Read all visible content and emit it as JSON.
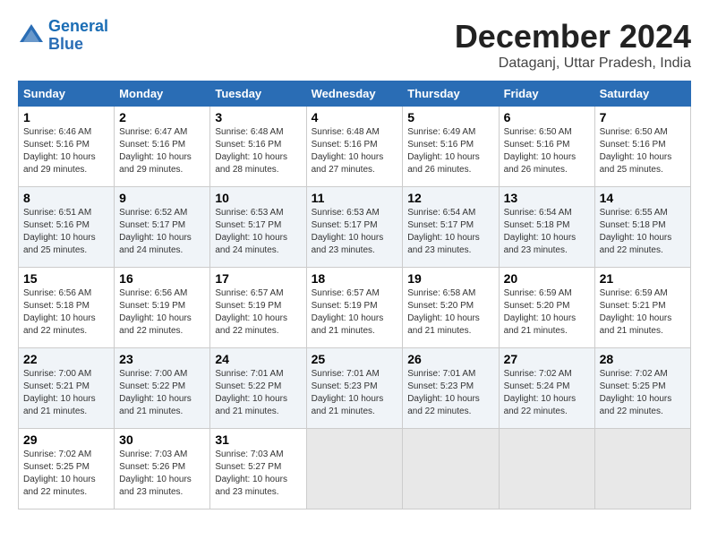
{
  "logo": {
    "line1": "General",
    "line2": "Blue"
  },
  "title": "December 2024",
  "location": "Dataganj, Uttar Pradesh, India",
  "days_of_week": [
    "Sunday",
    "Monday",
    "Tuesday",
    "Wednesday",
    "Thursday",
    "Friday",
    "Saturday"
  ],
  "weeks": [
    [
      {
        "day": "1",
        "sunrise": "Sunrise: 6:46 AM",
        "sunset": "Sunset: 5:16 PM",
        "daylight": "Daylight: 10 hours and 29 minutes."
      },
      {
        "day": "2",
        "sunrise": "Sunrise: 6:47 AM",
        "sunset": "Sunset: 5:16 PM",
        "daylight": "Daylight: 10 hours and 29 minutes."
      },
      {
        "day": "3",
        "sunrise": "Sunrise: 6:48 AM",
        "sunset": "Sunset: 5:16 PM",
        "daylight": "Daylight: 10 hours and 28 minutes."
      },
      {
        "day": "4",
        "sunrise": "Sunrise: 6:48 AM",
        "sunset": "Sunset: 5:16 PM",
        "daylight": "Daylight: 10 hours and 27 minutes."
      },
      {
        "day": "5",
        "sunrise": "Sunrise: 6:49 AM",
        "sunset": "Sunset: 5:16 PM",
        "daylight": "Daylight: 10 hours and 26 minutes."
      },
      {
        "day": "6",
        "sunrise": "Sunrise: 6:50 AM",
        "sunset": "Sunset: 5:16 PM",
        "daylight": "Daylight: 10 hours and 26 minutes."
      },
      {
        "day": "7",
        "sunrise": "Sunrise: 6:50 AM",
        "sunset": "Sunset: 5:16 PM",
        "daylight": "Daylight: 10 hours and 25 minutes."
      }
    ],
    [
      {
        "day": "8",
        "sunrise": "Sunrise: 6:51 AM",
        "sunset": "Sunset: 5:16 PM",
        "daylight": "Daylight: 10 hours and 25 minutes."
      },
      {
        "day": "9",
        "sunrise": "Sunrise: 6:52 AM",
        "sunset": "Sunset: 5:17 PM",
        "daylight": "Daylight: 10 hours and 24 minutes."
      },
      {
        "day": "10",
        "sunrise": "Sunrise: 6:53 AM",
        "sunset": "Sunset: 5:17 PM",
        "daylight": "Daylight: 10 hours and 24 minutes."
      },
      {
        "day": "11",
        "sunrise": "Sunrise: 6:53 AM",
        "sunset": "Sunset: 5:17 PM",
        "daylight": "Daylight: 10 hours and 23 minutes."
      },
      {
        "day": "12",
        "sunrise": "Sunrise: 6:54 AM",
        "sunset": "Sunset: 5:17 PM",
        "daylight": "Daylight: 10 hours and 23 minutes."
      },
      {
        "day": "13",
        "sunrise": "Sunrise: 6:54 AM",
        "sunset": "Sunset: 5:18 PM",
        "daylight": "Daylight: 10 hours and 23 minutes."
      },
      {
        "day": "14",
        "sunrise": "Sunrise: 6:55 AM",
        "sunset": "Sunset: 5:18 PM",
        "daylight": "Daylight: 10 hours and 22 minutes."
      }
    ],
    [
      {
        "day": "15",
        "sunrise": "Sunrise: 6:56 AM",
        "sunset": "Sunset: 5:18 PM",
        "daylight": "Daylight: 10 hours and 22 minutes."
      },
      {
        "day": "16",
        "sunrise": "Sunrise: 6:56 AM",
        "sunset": "Sunset: 5:19 PM",
        "daylight": "Daylight: 10 hours and 22 minutes."
      },
      {
        "day": "17",
        "sunrise": "Sunrise: 6:57 AM",
        "sunset": "Sunset: 5:19 PM",
        "daylight": "Daylight: 10 hours and 22 minutes."
      },
      {
        "day": "18",
        "sunrise": "Sunrise: 6:57 AM",
        "sunset": "Sunset: 5:19 PM",
        "daylight": "Daylight: 10 hours and 21 minutes."
      },
      {
        "day": "19",
        "sunrise": "Sunrise: 6:58 AM",
        "sunset": "Sunset: 5:20 PM",
        "daylight": "Daylight: 10 hours and 21 minutes."
      },
      {
        "day": "20",
        "sunrise": "Sunrise: 6:59 AM",
        "sunset": "Sunset: 5:20 PM",
        "daylight": "Daylight: 10 hours and 21 minutes."
      },
      {
        "day": "21",
        "sunrise": "Sunrise: 6:59 AM",
        "sunset": "Sunset: 5:21 PM",
        "daylight": "Daylight: 10 hours and 21 minutes."
      }
    ],
    [
      {
        "day": "22",
        "sunrise": "Sunrise: 7:00 AM",
        "sunset": "Sunset: 5:21 PM",
        "daylight": "Daylight: 10 hours and 21 minutes."
      },
      {
        "day": "23",
        "sunrise": "Sunrise: 7:00 AM",
        "sunset": "Sunset: 5:22 PM",
        "daylight": "Daylight: 10 hours and 21 minutes."
      },
      {
        "day": "24",
        "sunrise": "Sunrise: 7:01 AM",
        "sunset": "Sunset: 5:22 PM",
        "daylight": "Daylight: 10 hours and 21 minutes."
      },
      {
        "day": "25",
        "sunrise": "Sunrise: 7:01 AM",
        "sunset": "Sunset: 5:23 PM",
        "daylight": "Daylight: 10 hours and 21 minutes."
      },
      {
        "day": "26",
        "sunrise": "Sunrise: 7:01 AM",
        "sunset": "Sunset: 5:23 PM",
        "daylight": "Daylight: 10 hours and 22 minutes."
      },
      {
        "day": "27",
        "sunrise": "Sunrise: 7:02 AM",
        "sunset": "Sunset: 5:24 PM",
        "daylight": "Daylight: 10 hours and 22 minutes."
      },
      {
        "day": "28",
        "sunrise": "Sunrise: 7:02 AM",
        "sunset": "Sunset: 5:25 PM",
        "daylight": "Daylight: 10 hours and 22 minutes."
      }
    ],
    [
      {
        "day": "29",
        "sunrise": "Sunrise: 7:02 AM",
        "sunset": "Sunset: 5:25 PM",
        "daylight": "Daylight: 10 hours and 22 minutes."
      },
      {
        "day": "30",
        "sunrise": "Sunrise: 7:03 AM",
        "sunset": "Sunset: 5:26 PM",
        "daylight": "Daylight: 10 hours and 23 minutes."
      },
      {
        "day": "31",
        "sunrise": "Sunrise: 7:03 AM",
        "sunset": "Sunset: 5:27 PM",
        "daylight": "Daylight: 10 hours and 23 minutes."
      },
      null,
      null,
      null,
      null
    ]
  ]
}
